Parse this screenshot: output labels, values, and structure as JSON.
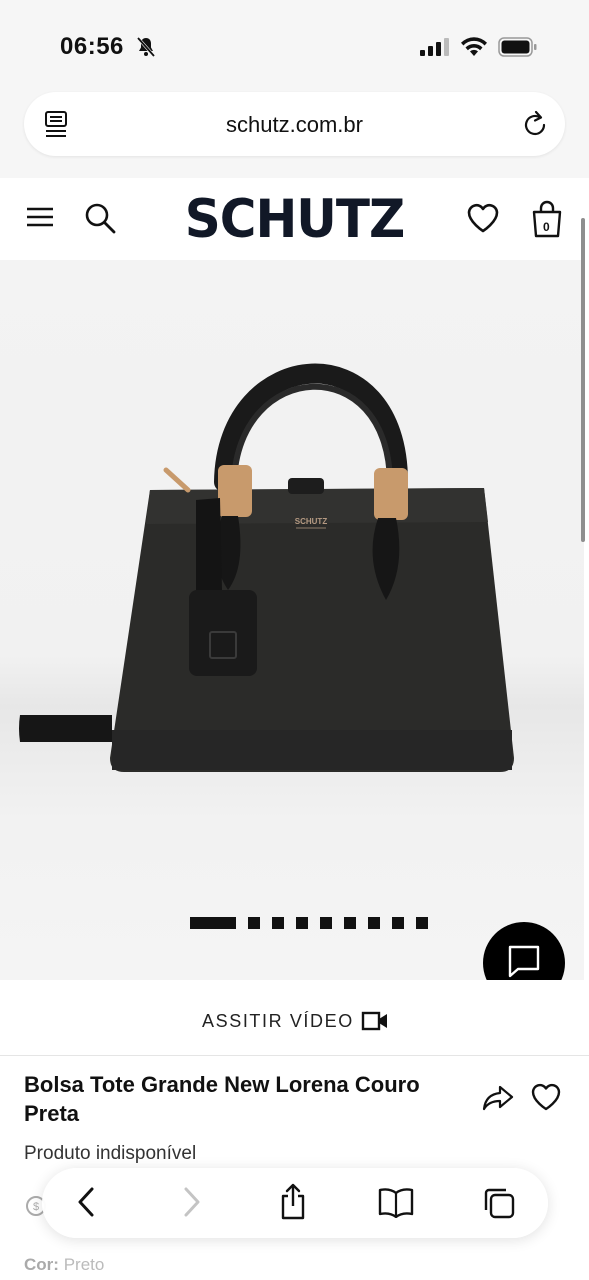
{
  "status_bar": {
    "time": "06:56",
    "icons": [
      "bell-slash-icon",
      "cellular-signal-icon",
      "wifi-icon",
      "battery-icon"
    ]
  },
  "browser": {
    "domain": "schutz.com.br",
    "reader_icon": "reader-mode-icon",
    "reload_icon": "reload-icon",
    "toolbar": {
      "icons": [
        "back-icon",
        "forward-icon",
        "share-icon",
        "bookmarks-icon",
        "tabs-icon"
      ]
    }
  },
  "site": {
    "logo": "SCHUTZ",
    "cart_count": "0",
    "icons": [
      "menu-icon",
      "search-icon",
      "wishlist-icon",
      "shopping-bag-icon"
    ]
  },
  "product": {
    "image": {
      "depicts": "black-tote-handbag",
      "slide_count": 9,
      "active_slide": 1,
      "brand_stamp": "SCHUTZ"
    },
    "video_label": "ASSITIR VÍDEO",
    "title": "Bolsa Tote Grande New Lorena Couro Preta",
    "availability": "Produto indisponível",
    "color_label": "Cor:",
    "color_value": "Preto"
  },
  "colors": {
    "brand_text": "#111827",
    "chat_button": "#000000",
    "page_bg": "#ffffff",
    "image_bg": "#f2f2f2"
  }
}
